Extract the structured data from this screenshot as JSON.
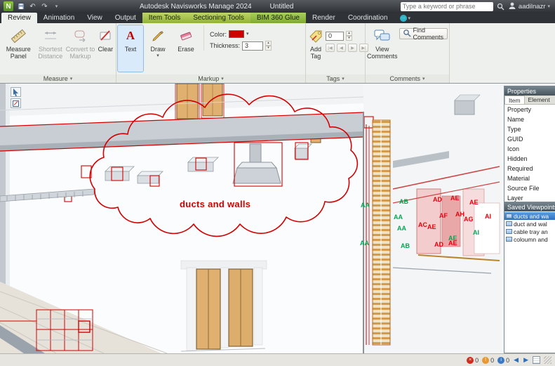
{
  "icons": {
    "app_letter": "N",
    "caret_down": "▾",
    "undo": "↶",
    "redo": "↷",
    "text_glyph": "A",
    "spin_up": "▴",
    "spin_down": "▾",
    "tag_first": "|◀",
    "tag_prev": "◀",
    "tag_next": "▶",
    "tag_last": "▶|",
    "nav_prev": "◀",
    "nav_next": "▶"
  },
  "titlebar": {
    "app_title": "Autodesk Navisworks Manage 2024",
    "doc_title": "Untitled",
    "search_placeholder": "Type a keyword or phrase",
    "username": "aadilnazr"
  },
  "tabs": {
    "review": "Review",
    "animation": "Animation",
    "view": "View",
    "output": "Output",
    "item_tools": "Item Tools",
    "sectioning_tools": "Sectioning Tools",
    "bim360_glue": "BIM 360 Glue",
    "render": "Render",
    "coordination": "Coordination"
  },
  "ribbon": {
    "measure_group": {
      "label": "Measure",
      "measure_panel": "Measure Panel",
      "shortest_distance": "Shortest Distance",
      "convert_to_markup": "Convert to Markup",
      "clear": "Clear"
    },
    "markup_group": {
      "label": "Markup",
      "text": "Text",
      "draw": "Draw",
      "erase": "Erase",
      "color_label": "Color:",
      "color_value": "#cc0000",
      "thickness_label": "Thickness:",
      "thickness_value": "3"
    },
    "tags_group": {
      "label": "Tags",
      "add_tag": "Add Tag",
      "tag_number": "0"
    },
    "comments_group": {
      "label": "Comments",
      "view_comments": "View Comments",
      "find_comments": "Find Comments"
    }
  },
  "viewport": {
    "cloud_text": "ducts and walls",
    "labels": [
      {
        "text": "AA",
        "color": "#00a651"
      },
      {
        "text": "AB",
        "color": "#00a651"
      },
      {
        "text": "AA",
        "color": "#00a651"
      },
      {
        "text": "AA",
        "color": "#00a651"
      },
      {
        "text": "AA",
        "color": "#00a651"
      },
      {
        "text": "AB",
        "color": "#00a651"
      },
      {
        "text": "AE",
        "color": "#00a651"
      },
      {
        "text": "AI",
        "color": "#00a651"
      },
      {
        "text": "AD",
        "color": "#e8000d"
      },
      {
        "text": "AE",
        "color": "#e8000d"
      },
      {
        "text": "AE",
        "color": "#e8000d"
      },
      {
        "text": "AF",
        "color": "#e8000d"
      },
      {
        "text": "AH",
        "color": "#e8000d"
      },
      {
        "text": "AG",
        "color": "#e8000d"
      },
      {
        "text": "AI",
        "color": "#e8000d"
      },
      {
        "text": "AC",
        "color": "#e8000d"
      },
      {
        "text": "AE",
        "color": "#e8000d"
      },
      {
        "text": "AD",
        "color": "#e8000d"
      },
      {
        "text": "AE",
        "color": "#e8000d"
      }
    ]
  },
  "properties": {
    "title": "Properties",
    "tab_item": "Item",
    "tab_element": "Element",
    "rows": [
      "Property",
      "Name",
      "Type",
      "GUID",
      "Icon",
      "Hidden",
      "Required",
      "Material",
      "Source File",
      "Layer"
    ]
  },
  "viewpoints": {
    "title": "Saved Viewpoints",
    "items": [
      "ducts and wa",
      "duct and wal",
      "cable tray an",
      "coloumn and"
    ]
  },
  "statusbar": {
    "refresh_count": "0",
    "disk_count": "0",
    "web_count": "0"
  }
}
